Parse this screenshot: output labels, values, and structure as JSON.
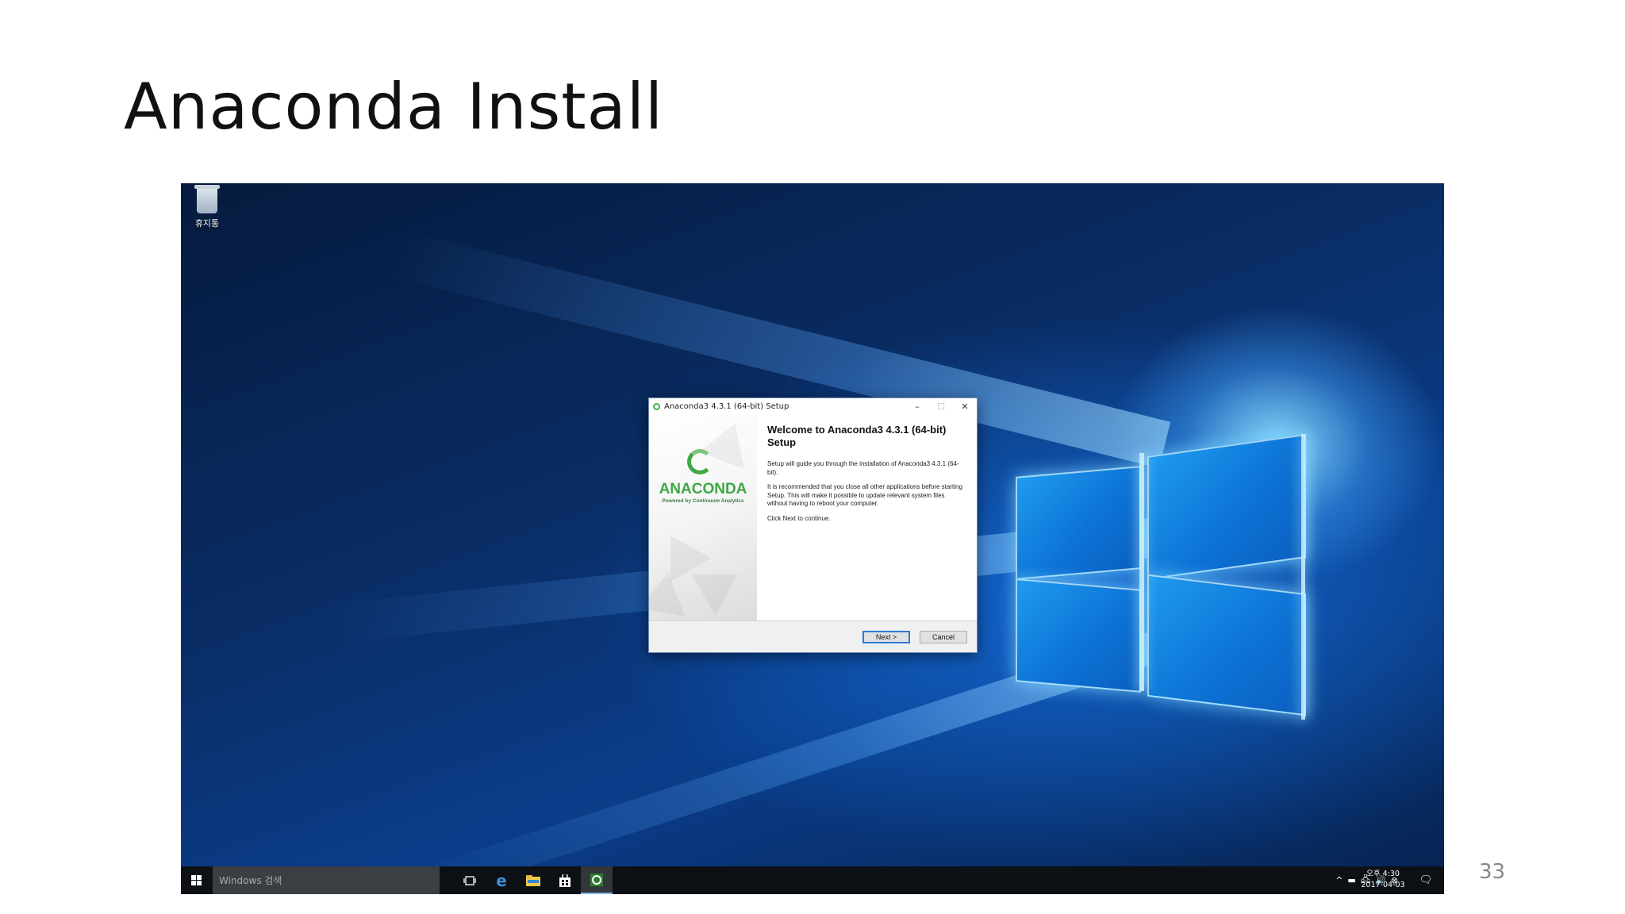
{
  "slide": {
    "title": "Anaconda Install",
    "page_number": "33"
  },
  "desktop": {
    "recycle_bin_label": "휴지통"
  },
  "dialog": {
    "title": "Anaconda3 4.3.1 (64-bit) Setup",
    "minimize": "–",
    "maximize": "☐",
    "close": "✕",
    "logo_text": "ANACONDA",
    "logo_subtext": "Powered by Continuum Analytics",
    "heading": "Welcome to Anaconda3 4.3.1 (64-bit) Setup",
    "paragraph1": "Setup will guide you through the installation of Anaconda3 4.3.1 (64-bit).",
    "paragraph2": "It is recommended that you close all other applications before starting Setup. This will make it possible to update relevant system files without having to reboot your computer.",
    "paragraph3": "Click Next to continue.",
    "next_label": "Next >",
    "cancel_label": "Cancel"
  },
  "taskbar": {
    "search_placeholder": "Windows 검색",
    "time": "오후 4:30",
    "date": "2017-04-03",
    "tray_up": "^",
    "notification": "🗨"
  },
  "icons": {
    "start": "windows-logo-icon",
    "task_view": "task-view-icon",
    "edge": "edge-icon",
    "explorer": "file-explorer-icon",
    "store": "store-icon",
    "anaconda": "anaconda-installer-icon"
  }
}
